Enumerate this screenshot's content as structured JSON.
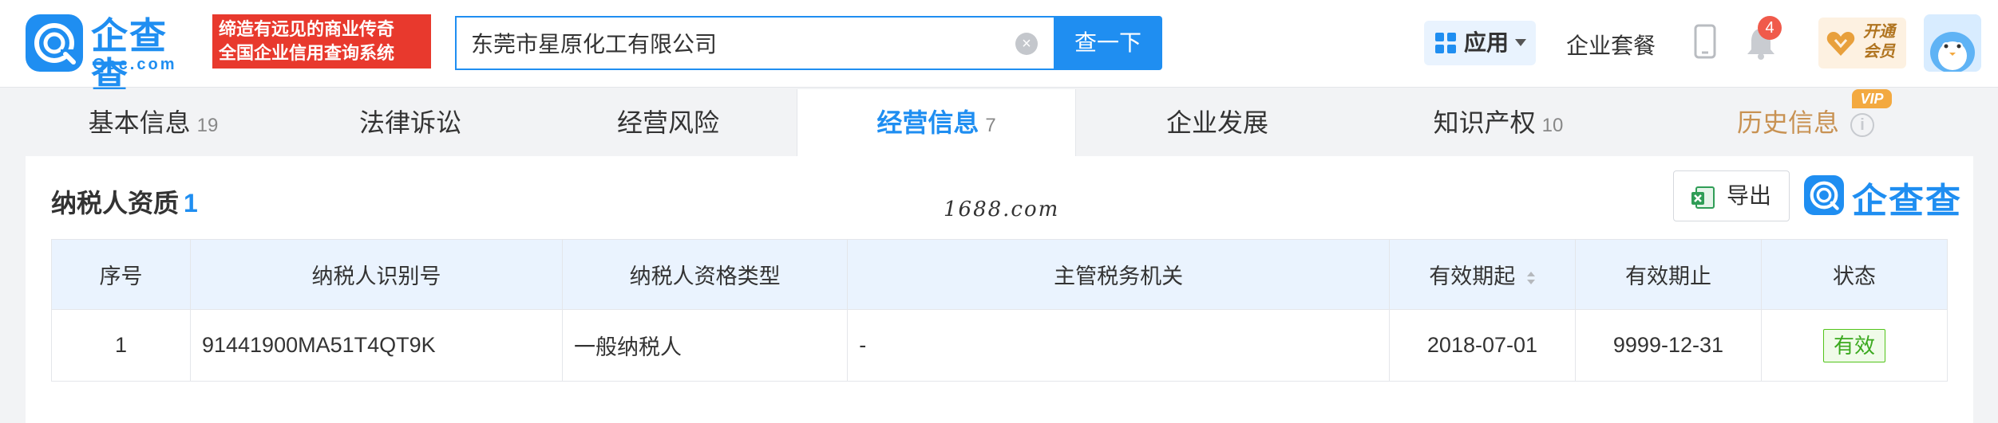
{
  "header": {
    "logo_text": "企查查",
    "logo_sub": "Qcc.com",
    "slogan": [
      "缔造有远见的商业传奇",
      "全国企业信用查询系统"
    ],
    "search": {
      "value": "东莞市星原化工有限公司",
      "button_label": "查一下"
    },
    "app_label": "应用",
    "package_label": "企业套餐",
    "notification_count": "4",
    "vip_open_lines": [
      "开通",
      "会员"
    ]
  },
  "tabs": [
    {
      "label": "基本信息",
      "count": "19"
    },
    {
      "label": "法律诉讼",
      "count": ""
    },
    {
      "label": "经营风险",
      "count": ""
    },
    {
      "label": "经营信息",
      "count": "7",
      "active": true
    },
    {
      "label": "企业发展",
      "count": ""
    },
    {
      "label": "知识产权",
      "count": "10"
    },
    {
      "label": "历史信息",
      "count": "",
      "vip": true
    }
  ],
  "vip_tag": "VIP",
  "section": {
    "title": "纳税人资质",
    "count": "1",
    "watermark": "1688.com",
    "export_label": "导出",
    "mini_logo_text": "企查查"
  },
  "table": {
    "columns": [
      "序号",
      "纳税人识别号",
      "纳税人资格类型",
      "主管税务机关",
      "有效期起",
      "有效期止",
      "状态"
    ],
    "rows": [
      [
        "1",
        "91441900MA51T4QT9K",
        "一般纳税人",
        "-",
        "2018-07-01",
        "9999-12-31",
        "有效"
      ]
    ]
  },
  "colors": {
    "brand_blue": "#1f8ef1",
    "slogan_red": "#e8392d",
    "status_green": "#52c41a",
    "vip_gold": "#c89253"
  }
}
